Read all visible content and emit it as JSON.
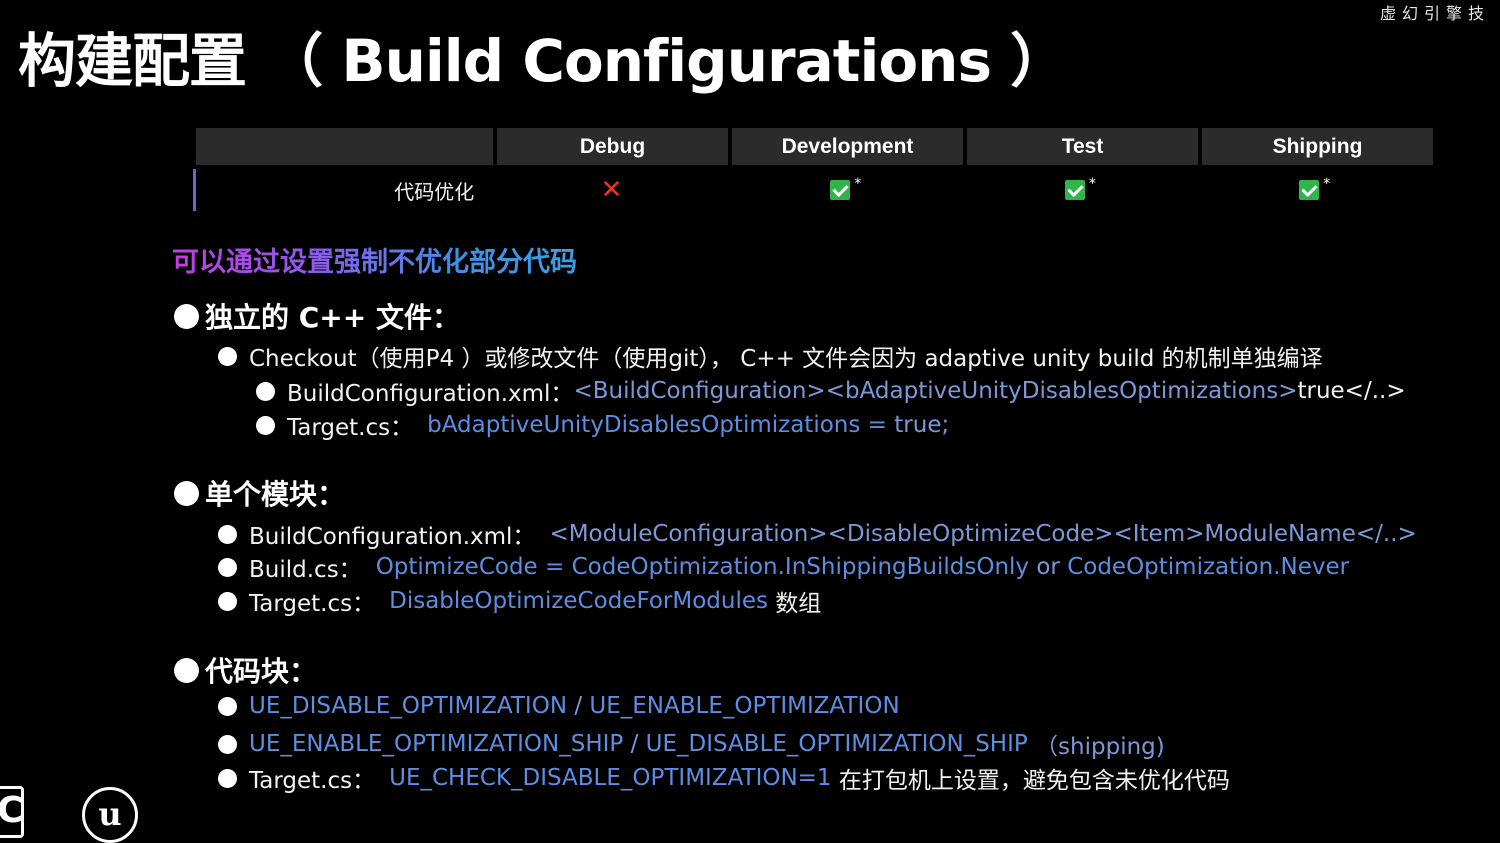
{
  "title": "构建配置 （ Build Configurations ）",
  "brand": "虚幻引擎技",
  "table": {
    "headers": [
      "",
      "Debug",
      "Development",
      "Test",
      "Shipping"
    ],
    "row_label": "代码优化",
    "cells": [
      {
        "status": "cross",
        "symbol": "✕",
        "note": ""
      },
      {
        "status": "check",
        "symbol": "",
        "note": "*"
      },
      {
        "status": "check",
        "symbol": "",
        "note": "*"
      },
      {
        "status": "check",
        "symbol": "",
        "note": "*"
      }
    ]
  },
  "subtitle": "可以通过设置强制不优化部分代码",
  "sections": [
    {
      "heading": "独立的 C++ 文件：",
      "items": [
        {
          "a": "Checkout（使用P4 ）或修改文件（使用git）， C++ 文件会因为 adaptive unity build 的机制单独编译"
        },
        {
          "a": "BuildConfiguration.xml：",
          "b": "<BuildConfiguration><bAdaptiveUnityDisablesOptimizations>",
          "c": "true</..>"
        },
        {
          "a": "Target.cs：",
          "b": "bAdaptiveUnityDisablesOptimizations",
          "c": " = ",
          "d": "true;"
        }
      ]
    },
    {
      "heading": "单个模块：",
      "items": [
        {
          "a": "BuildConfiguration.xml：",
          "b": "<ModuleConfiguration><DisableOptimizeCode><Item>",
          "c": "ModuleName</..>"
        },
        {
          "a": "Build.cs：",
          "b": "OptimizeCode",
          "c": " = ",
          "d": "CodeOptimization.InShippingBuildsOnly",
          "e": " or ",
          "f": "CodeOptimization.Never"
        },
        {
          "a": "Target.cs：",
          "b": "DisableOptimizeCodeForModules",
          "c": " 数组"
        }
      ]
    },
    {
      "heading": "代码块：",
      "items": [
        {
          "a": "UE_DISABLE_OPTIMIZATION",
          "b": " / ",
          "c": "UE_ENABLE_OPTIMIZATION"
        },
        {
          "a": "UE_ENABLE_OPTIMIZATION_SHIP",
          "b": " / ",
          "c": "UE_DISABLE_OPTIMIZATION_SHIP",
          "d": " （shipping)"
        },
        {
          "a": "Target.cs：",
          "b": "UE_CHECK_DISABLE_OPTIMIZATION=1",
          "c": " 在打包机上设置，避免包含未优化代码"
        }
      ]
    }
  ],
  "logos": {
    "left": "C",
    "ue": "u"
  },
  "colors": {
    "background": "#000000",
    "accent_blue": "#5f8de0",
    "cross_red": "#e8362a",
    "check_green": "#2fb54a",
    "row_marker": "#6e64d6"
  }
}
